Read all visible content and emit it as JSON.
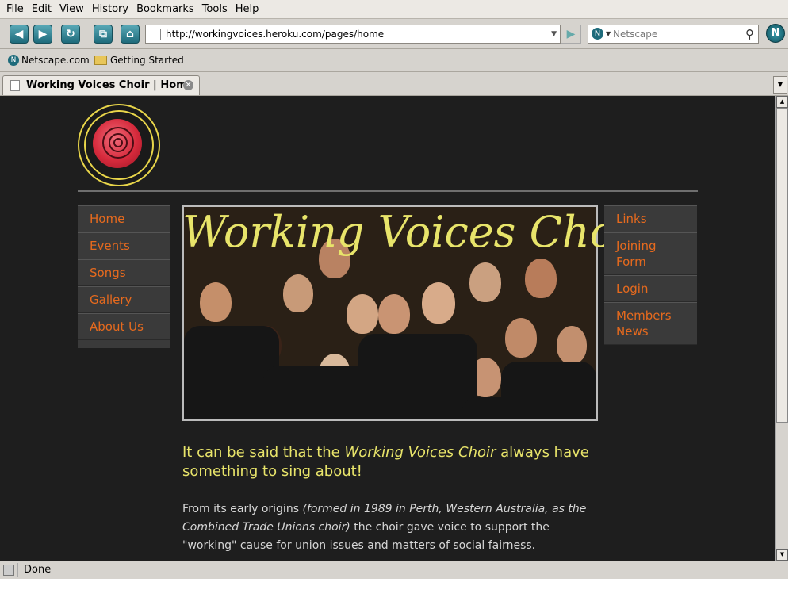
{
  "menu": [
    "File",
    "Edit",
    "View",
    "History",
    "Bookmarks",
    "Tools",
    "Help"
  ],
  "toolbar": {
    "back_icon": "back-arrow",
    "forward_icon": "forward-arrow",
    "reload_icon": "reload",
    "newtab_icon": "new-tab",
    "home_icon": "home",
    "url": "http://workingvoices.heroku.com/pages/home",
    "search_placeholder": "Netscape",
    "brand": "N"
  },
  "bookmarks": [
    "Netscape.com",
    "Getting Started"
  ],
  "tab": {
    "title": "Working Voices Choir | Home"
  },
  "status": "Done",
  "page": {
    "hero_title": "Working Voices Choir",
    "left_nav": [
      "Home",
      "Events",
      "Songs",
      "Gallery",
      "About Us"
    ],
    "right_nav": [
      "Links",
      "Joining Form",
      "Login",
      "Members News"
    ],
    "tagline_pre": "It can be said that the ",
    "tagline_em": "Working Voices Choir",
    "tagline_post": " always have something to sing about!",
    "para_pre": "From its early origins ",
    "para_em": "(formed in 1989 in Perth, Western Australia, as the Combined Trade Unions choir)",
    "para_post": " the choir gave voice to support the \"working\" cause for union issues and matters of social fairness."
  },
  "colors": {
    "nav_link": "#e66a1e",
    "accent_yellow": "#e8e46a",
    "page_bg": "#1e1e1e"
  }
}
